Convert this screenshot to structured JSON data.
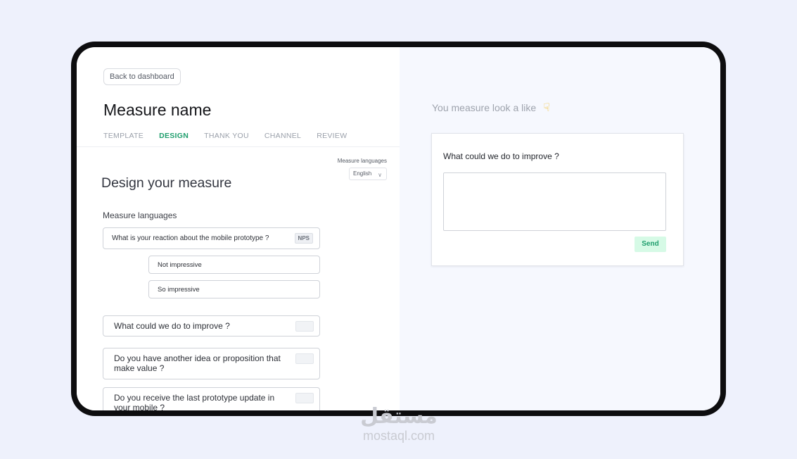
{
  "nav": {
    "back_label": "Back to dashboard"
  },
  "measure": {
    "title": "Measure name"
  },
  "steps": [
    "TEMPLATE",
    "DESIGN",
    "THANK YOU",
    "CHANNEL",
    "REVIEW"
  ],
  "active_step": "DESIGN",
  "language": {
    "label": "Measure languages",
    "selected": "English"
  },
  "design": {
    "title": "Design your measure",
    "section_label": "Measure languages",
    "questions": [
      {
        "text": "What is your reaction about the mobile prototype ?",
        "badge": "NPS"
      },
      {
        "text": "What could we do to improve ?"
      },
      {
        "text": "Do you have another idea or proposition that make value ?"
      },
      {
        "text": "Do you receive the last prototype update in your mobile ?"
      }
    ],
    "options": [
      "Not impressive",
      "So impressive"
    ]
  },
  "preview": {
    "heading": "You measure look a like",
    "hand_icon": "pointing-down-hand-icon",
    "question": "What could we do to improve ?",
    "send_label": "Send"
  },
  "watermark": {
    "arabic": "مستقل",
    "latin": "mostaql.com"
  },
  "colors": {
    "accent": "#1f9e6d",
    "send_bg": "#d6fae6",
    "page_bg": "#eef1fc",
    "preview_bg": "#f6f8fe"
  }
}
